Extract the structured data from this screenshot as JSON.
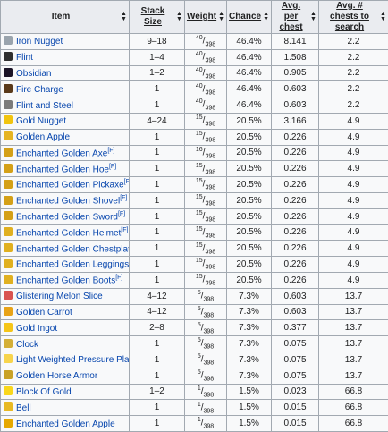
{
  "headers": {
    "item": "Item",
    "stack_size": "Stack Size",
    "weight": "Weight",
    "chance": "Chance",
    "avg_per_chest": "Avg. per chest",
    "avg_chests_to_search": "Avg. # chests to search"
  },
  "sort_icon": "sort-arrows-icon",
  "rows": [
    {
      "item": "Iron Nugget",
      "icon": "iron-nugget-icon",
      "color": "#9aa4ad",
      "ref": "",
      "stack": "9–18",
      "w_num": "40",
      "w_den": "398",
      "chance": "46.4%",
      "avg": "8.141",
      "search": "2.2"
    },
    {
      "item": "Flint",
      "icon": "flint-icon",
      "color": "#2f2f2f",
      "ref": "",
      "stack": "1–4",
      "w_num": "40",
      "w_den": "398",
      "chance": "46.4%",
      "avg": "1.508",
      "search": "2.2"
    },
    {
      "item": "Obsidian",
      "icon": "obsidian-icon",
      "color": "#1a1326",
      "ref": "",
      "stack": "1–2",
      "w_num": "40",
      "w_den": "398",
      "chance": "46.4%",
      "avg": "0.905",
      "search": "2.2"
    },
    {
      "item": "Fire Charge",
      "icon": "fire-charge-icon",
      "color": "#5a3a1a",
      "ref": "",
      "stack": "1",
      "w_num": "40",
      "w_den": "398",
      "chance": "46.4%",
      "avg": "0.603",
      "search": "2.2"
    },
    {
      "item": "Flint and Steel",
      "icon": "flint-and-steel-icon",
      "color": "#7b7b7b",
      "ref": "",
      "stack": "1",
      "w_num": "40",
      "w_den": "398",
      "chance": "46.4%",
      "avg": "0.603",
      "search": "2.2"
    },
    {
      "item": "Gold Nugget",
      "icon": "gold-nugget-icon",
      "color": "#f1c40f",
      "ref": "",
      "stack": "4–24",
      "w_num": "15",
      "w_den": "398",
      "chance": "20.5%",
      "avg": "3.166",
      "search": "4.9"
    },
    {
      "item": "Golden Apple",
      "icon": "golden-apple-icon",
      "color": "#e6b422",
      "ref": "",
      "stack": "1",
      "w_num": "15",
      "w_den": "398",
      "chance": "20.5%",
      "avg": "0.226",
      "search": "4.9"
    },
    {
      "item": "Enchanted Golden Axe",
      "icon": "golden-axe-icon",
      "color": "#d4a017",
      "ref": "[F]",
      "stack": "1",
      "w_num": "16",
      "w_den": "398",
      "chance": "20.5%",
      "avg": "0.226",
      "search": "4.9"
    },
    {
      "item": "Enchanted Golden Hoe",
      "icon": "golden-hoe-icon",
      "color": "#d4a017",
      "ref": "[F]",
      "stack": "1",
      "w_num": "15",
      "w_den": "398",
      "chance": "20.5%",
      "avg": "0.226",
      "search": "4.9"
    },
    {
      "item": "Enchanted Golden Pickaxe",
      "icon": "golden-pickaxe-icon",
      "color": "#d4a017",
      "ref": "[F]",
      "stack": "1",
      "w_num": "15",
      "w_den": "398",
      "chance": "20.5%",
      "avg": "0.226",
      "search": "4.9"
    },
    {
      "item": "Enchanted Golden Shovel",
      "icon": "golden-shovel-icon",
      "color": "#d4a017",
      "ref": "[F]",
      "stack": "1",
      "w_num": "15",
      "w_den": "398",
      "chance": "20.5%",
      "avg": "0.226",
      "search": "4.9"
    },
    {
      "item": "Enchanted Golden Sword",
      "icon": "golden-sword-icon",
      "color": "#d4a017",
      "ref": "[F]",
      "stack": "1",
      "w_num": "15",
      "w_den": "398",
      "chance": "20.5%",
      "avg": "0.226",
      "search": "4.9"
    },
    {
      "item": "Enchanted Golden Helmet",
      "icon": "golden-helmet-icon",
      "color": "#e0b020",
      "ref": "[F]",
      "stack": "1",
      "w_num": "15",
      "w_den": "398",
      "chance": "20.5%",
      "avg": "0.226",
      "search": "4.9"
    },
    {
      "item": "Enchanted Golden Chestplate",
      "icon": "golden-chestplate-icon",
      "color": "#e0b020",
      "ref": "[F]",
      "stack": "1",
      "w_num": "15",
      "w_den": "398",
      "chance": "20.5%",
      "avg": "0.226",
      "search": "4.9"
    },
    {
      "item": "Enchanted Golden Leggings",
      "icon": "golden-leggings-icon",
      "color": "#e0b020",
      "ref": "[F]",
      "stack": "1",
      "w_num": "15",
      "w_den": "398",
      "chance": "20.5%",
      "avg": "0.226",
      "search": "4.9"
    },
    {
      "item": "Enchanted Golden Boots",
      "icon": "golden-boots-icon",
      "color": "#e0b020",
      "ref": "[F]",
      "stack": "1",
      "w_num": "15",
      "w_den": "398",
      "chance": "20.5%",
      "avg": "0.226",
      "search": "4.9"
    },
    {
      "item": "Glistering Melon Slice",
      "icon": "glistering-melon-icon",
      "color": "#d9534f",
      "ref": "",
      "stack": "4–12",
      "w_num": "5",
      "w_den": "398",
      "chance": "7.3%",
      "avg": "0.603",
      "search": "13.7"
    },
    {
      "item": "Golden Carrot",
      "icon": "golden-carrot-icon",
      "color": "#e8a317",
      "ref": "",
      "stack": "4–12",
      "w_num": "5",
      "w_den": "398",
      "chance": "7.3%",
      "avg": "0.603",
      "search": "13.7"
    },
    {
      "item": "Gold Ingot",
      "icon": "gold-ingot-icon",
      "color": "#f5c518",
      "ref": "",
      "stack": "2–8",
      "w_num": "5",
      "w_den": "398",
      "chance": "7.3%",
      "avg": "0.377",
      "search": "13.7"
    },
    {
      "item": "Clock",
      "icon": "clock-icon",
      "color": "#d4af37",
      "ref": "",
      "stack": "1",
      "w_num": "5",
      "w_den": "398",
      "chance": "7.3%",
      "avg": "0.075",
      "search": "13.7"
    },
    {
      "item": "Light Weighted Pressure Plate",
      "icon": "pressure-plate-icon",
      "color": "#f7d44c",
      "ref": "",
      "stack": "1",
      "w_num": "5",
      "w_den": "398",
      "chance": "7.3%",
      "avg": "0.075",
      "search": "13.7"
    },
    {
      "item": "Golden Horse Armor",
      "icon": "horse-armor-icon",
      "color": "#c9a227",
      "ref": "",
      "stack": "1",
      "w_num": "5",
      "w_den": "398",
      "chance": "7.3%",
      "avg": "0.075",
      "search": "13.7"
    },
    {
      "item": "Block Of Gold",
      "icon": "gold-block-icon",
      "color": "#f9d71c",
      "ref": "",
      "stack": "1–2",
      "w_num": "1",
      "w_den": "398",
      "chance": "1.5%",
      "avg": "0.023",
      "search": "66.8"
    },
    {
      "item": "Bell",
      "icon": "bell-icon",
      "color": "#e8b923",
      "ref": "",
      "stack": "1",
      "w_num": "1",
      "w_den": "398",
      "chance": "1.5%",
      "avg": "0.015",
      "search": "66.8"
    },
    {
      "item": "Enchanted Golden Apple",
      "icon": "enchanted-golden-apple-icon",
      "color": "#e6a800",
      "ref": "",
      "stack": "1",
      "w_num": "1",
      "w_den": "398",
      "chance": "1.5%",
      "avg": "0.015",
      "search": "66.8"
    }
  ]
}
